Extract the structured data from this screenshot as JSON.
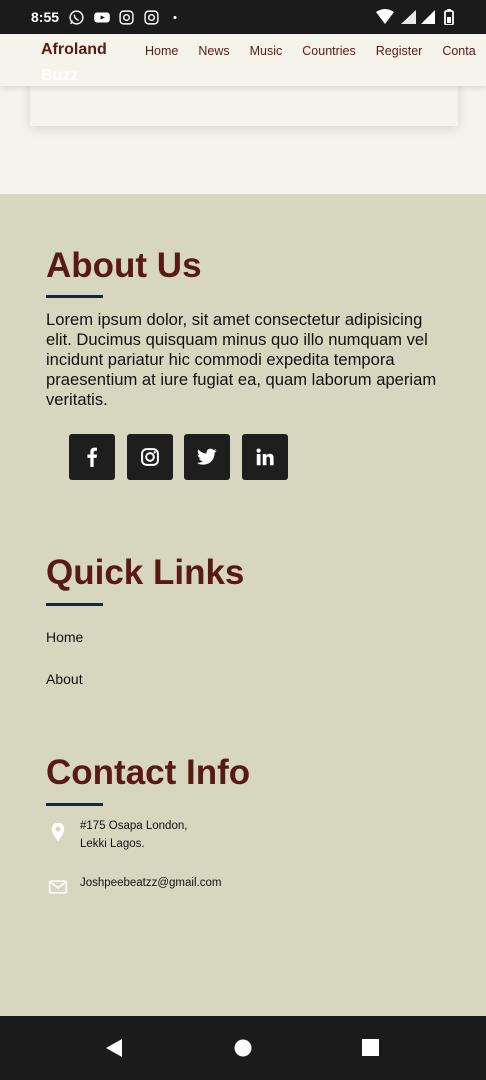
{
  "status_bar": {
    "time": "8:55"
  },
  "header": {
    "brand_line1": "Afroland",
    "brand_line2": "Buzz",
    "nav": [
      "Home",
      "News",
      "Music",
      "Countries",
      "Register",
      "Conta"
    ]
  },
  "about": {
    "title": "About Us",
    "text": "Lorem ipsum dolor, sit amet consectetur adipisicing elit. Ducimus quisquam minus quo illo numquam vel incidunt pariatur hic commodi expedita tempora praesentium at iure fugiat ea, quam laborum aperiam veritatis.",
    "socials": [
      "facebook-icon",
      "instagram-icon",
      "twitter-icon",
      "linkedin-icon"
    ]
  },
  "quick_links": {
    "title": "Quick Links",
    "links": [
      "Home",
      "About"
    ]
  },
  "contact": {
    "title": "Contact Info",
    "address_line1": "#175 Osapa London,",
    "address_line2": "Lekki Lagos.",
    "email": "Joshpeebeatzz@gmail.com"
  },
  "colors": {
    "brand": "#5a1a14",
    "footer_bg": "#d7d7bf",
    "page_bg": "#f6f4ea",
    "dark": "#1e1e1e"
  }
}
